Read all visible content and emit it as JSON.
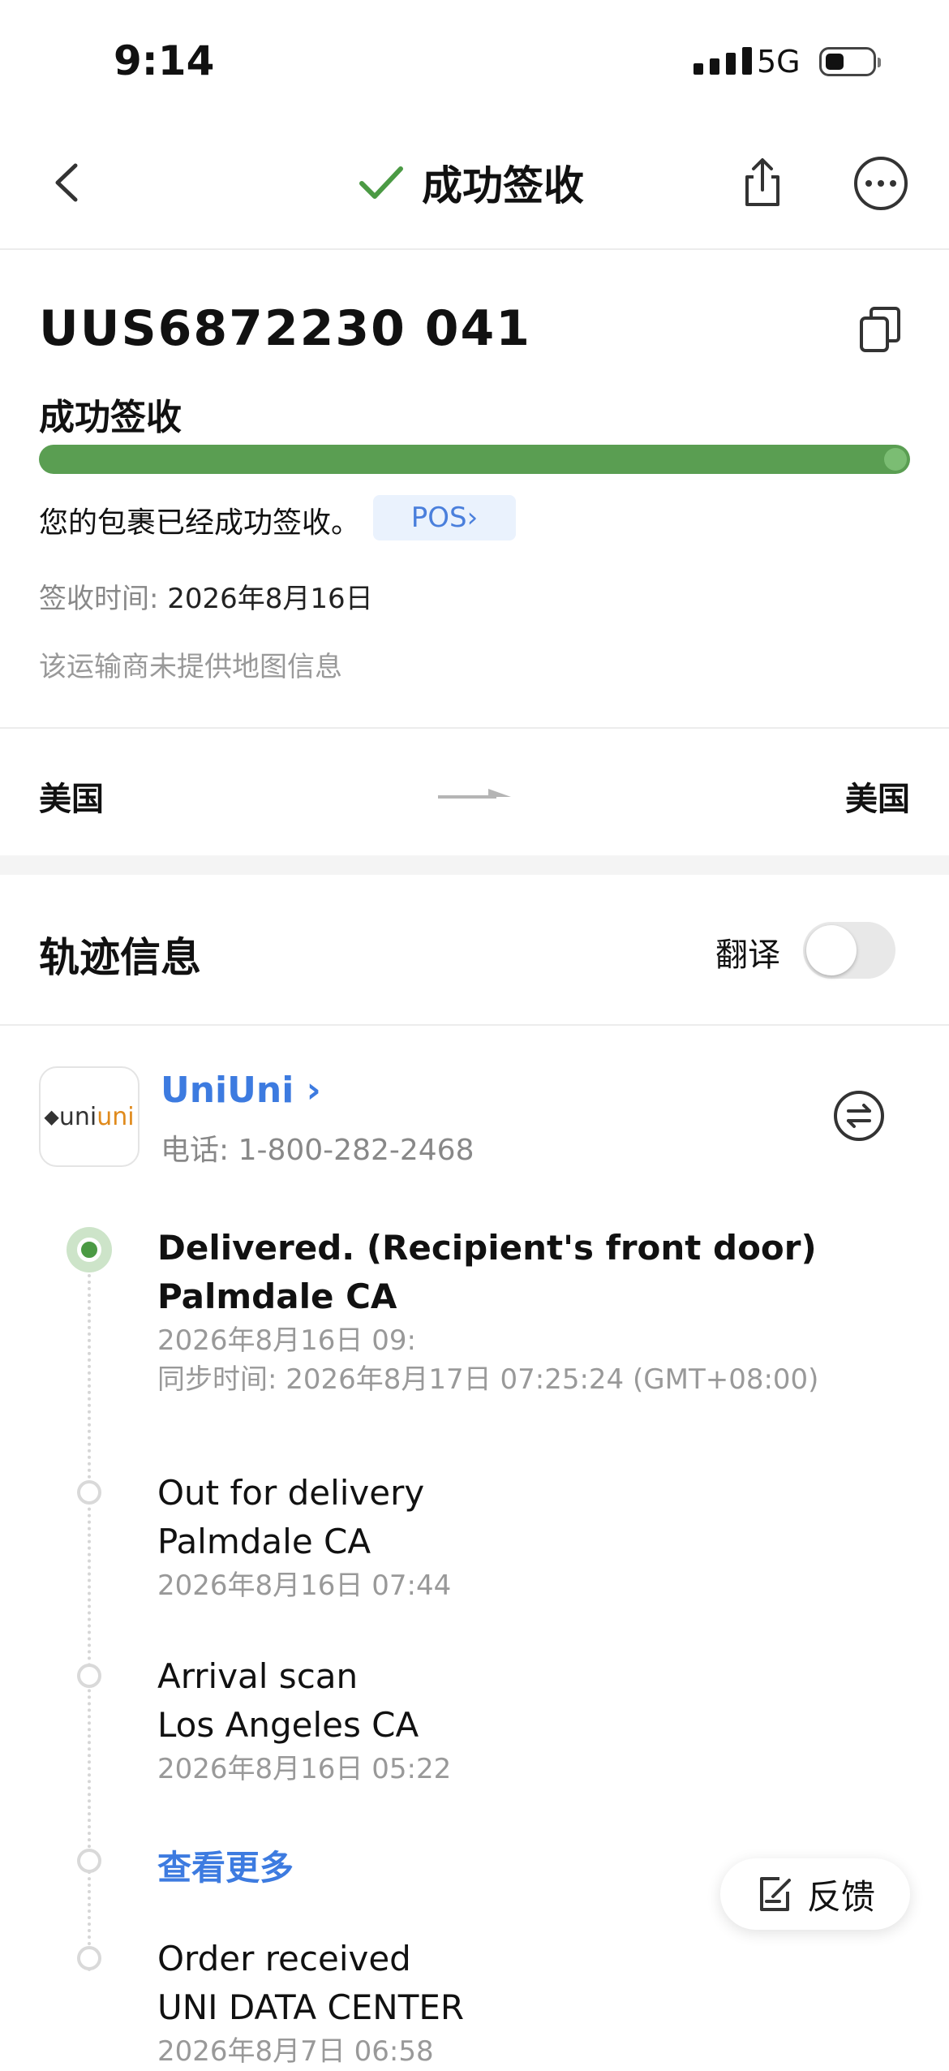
{
  "status_bar": {
    "time": "9:14",
    "network": "5G"
  },
  "nav": {
    "title": "成功签收",
    "title_icon": "check-icon",
    "share_icon": "share-icon",
    "more_icon": "more-icon"
  },
  "summary": {
    "tracking_number": "UUS6872230 041",
    "status": "成功签收",
    "progress": 1.0,
    "message": "您的包裹已经成功签收。",
    "chip": "POS",
    "signed_label": "签收时间",
    "signed_date": "2026年8月16日",
    "map_note": "该运输商未提供地图信息",
    "origin": "美国",
    "destination": "美国"
  },
  "tracking": {
    "section_title": "轨迹信息",
    "translate_label": "翻译",
    "translate_on": false,
    "carrier": {
      "logo_text_1": "uni",
      "logo_text_2": "uni",
      "name": "UniUni",
      "phone": "电话: 1-800-282-2468"
    },
    "events": [
      {
        "title": "Delivered. (Recipient's front door)",
        "location": "Palmdale CA",
        "time": "2026年8月16日 09:",
        "sync": "同步时间: 2026年8月17日 07:25:24 (GMT+08:00)"
      },
      {
        "title": "Out for delivery",
        "location": "Palmdale CA",
        "time": "2026年8月16日 07:44"
      },
      {
        "title": "Arrival scan",
        "location": "Los Angeles CA",
        "time": "2026年8月16日 05:22"
      },
      {
        "title": "Order received",
        "location": "UNI DATA CENTER",
        "time": "2026年8月7日 06:58"
      }
    ],
    "see_more": "查看更多"
  },
  "feedback": {
    "label": "反馈"
  }
}
